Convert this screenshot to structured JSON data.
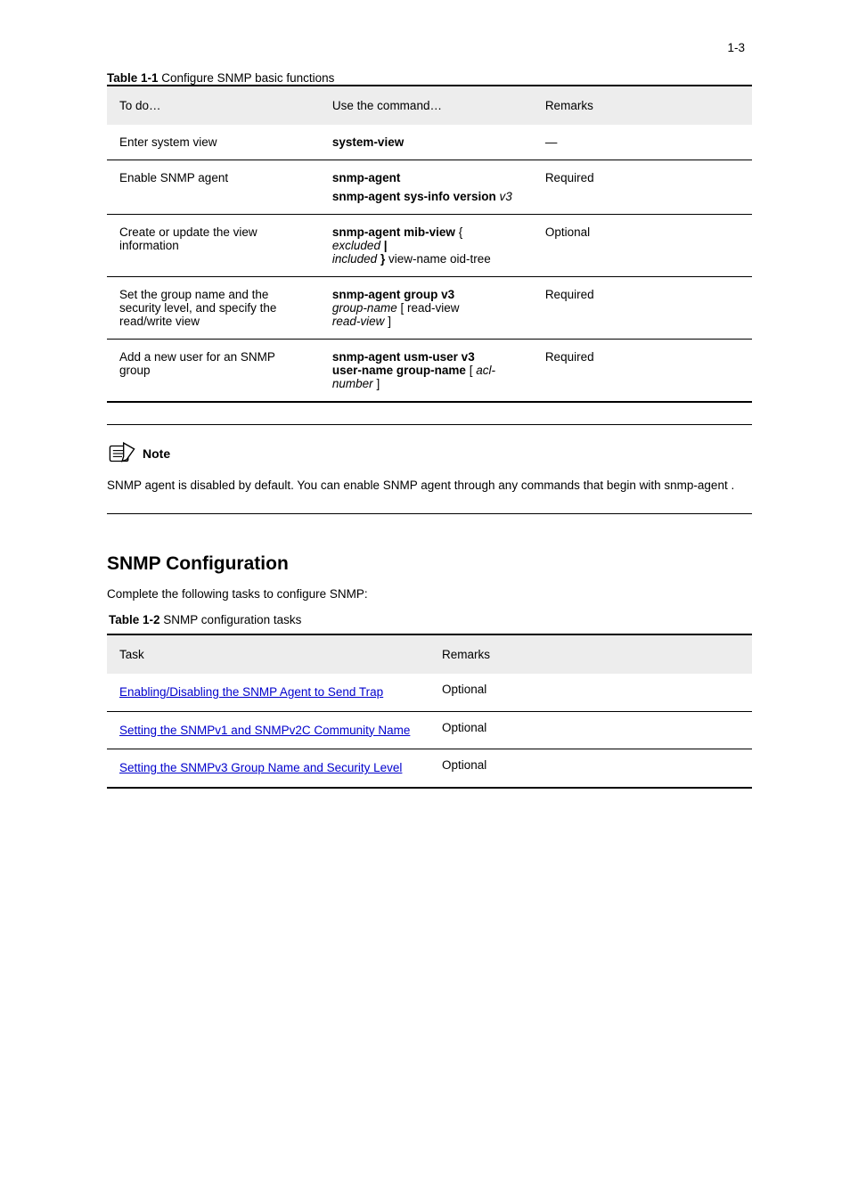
{
  "page_number": "1-3",
  "table1": {
    "caption_strong": "Table 1-1",
    "caption_rest": "Configure SNMP basic functions",
    "headers": [
      "To do…",
      "Use the command…",
      "Remarks"
    ],
    "rows": [
      {
        "0": "Enter system view",
        "1": "system-view",
        "2": "—"
      },
      {
        "0": "Enable SNMP agent",
        "1a": "snmp-agent",
        "1b": "",
        "1c": "",
        "1d": "snmp-agent sys-info version",
        "1e": "v3",
        "2": "Required"
      },
      {
        "0": "Create or update the view information",
        "1a": "snmp-agent mib-view",
        "1b": " {",
        "1c": " excluded",
        "1d": " |",
        "1e": "",
        "1f": "included",
        "1g": " }",
        "1h": " view-name oid-tree",
        "2": "Optional"
      },
      {
        "0": "Set the group name and the security level, and specify the read/write view",
        "1a": "snmp-agent group v3",
        "1b": "group-name",
        "1c": " [ read-view",
        "1d": "read-view",
        "1e": " ]",
        "2": "Required"
      },
      {
        "0": "Add a new user for an SNMP group",
        "1a": "snmp-agent usm-user v3",
        "1b": "user-name group-name",
        "1c": " [",
        "1d": "acl-number",
        "1e": " ]",
        "2": "Required"
      }
    ]
  },
  "note": {
    "label": "Note",
    "body_a": "SNMP agent is disabled by default. You can enable SNMP agent through any commands that begin with ",
    "body_b": "snmp-agent",
    "body_c": "."
  },
  "section": {
    "heading": "SNMP Configuration",
    "lead": "Complete the following tasks to configure SNMP:"
  },
  "table2": {
    "caption_strong": "Table 1-2",
    "caption_rest": "SNMP configuration tasks",
    "headers": [
      "Task",
      "Remarks"
    ],
    "rows": [
      {
        "link": "Enabling/Disabling the SNMP Agent to Send Trap",
        "remarks": "Optional"
      },
      {
        "link": "Setting the SNMPv1 and SNMPv2C Community Name",
        "remarks": "Optional"
      },
      {
        "link": "Setting the SNMPv3 Group Name and Security Level",
        "remarks": "Optional"
      }
    ]
  }
}
